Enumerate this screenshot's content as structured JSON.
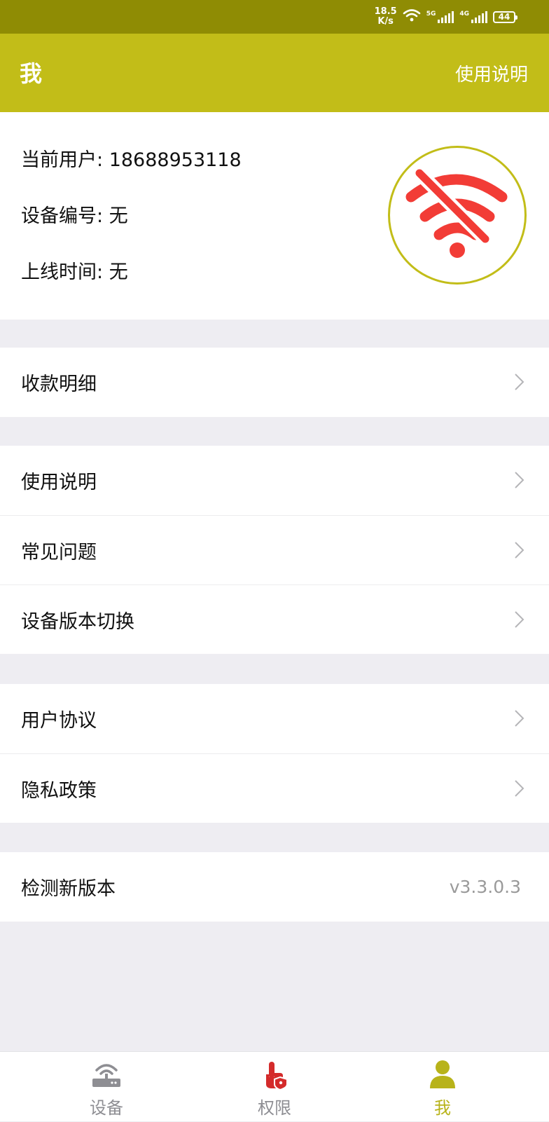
{
  "status_bar": {
    "speed_value": "18.5",
    "speed_unit": "K/s",
    "sim1_tag": "5G",
    "sim2_tag": "4G",
    "battery": "44"
  },
  "header": {
    "title": "我",
    "help_link": "使用说明"
  },
  "profile": {
    "user_label": "当前用户:",
    "user_value": "18688953118",
    "device_label": "设备编号:",
    "device_value": "无",
    "online_label": "上线时间:",
    "online_value": "无",
    "status_icon": "wifi-off-icon",
    "status_color": "#f23c36",
    "ring_color": "#c2bd18"
  },
  "menu": {
    "payments": "收款明细",
    "instructions": "使用说明",
    "faq": "常见问题",
    "device_version_switch": "设备版本切换",
    "user_agreement": "用户协议",
    "privacy_policy": "隐私政策",
    "check_update": "检测新版本",
    "version": "v3.3.0.3"
  },
  "tabs": {
    "device": "设备",
    "permission": "权限",
    "me": "我"
  },
  "colors": {
    "header_bg": "#c2bd18",
    "status_bar_bg": "#8f8c04",
    "active_tab": "#b8b31a",
    "inactive_tab": "#8e8e93",
    "permission_icon": "#d42b2b"
  }
}
